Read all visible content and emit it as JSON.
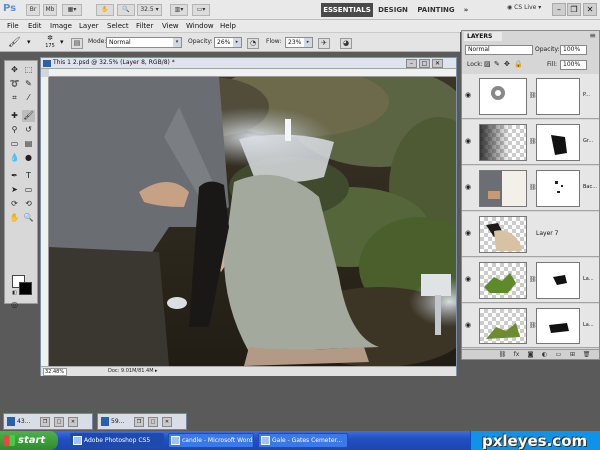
{
  "app": {
    "logo": "Ps",
    "zoom": "32.5",
    "workspaces": [
      "ESSENTIALS",
      "DESIGN",
      "PAINTING",
      "»"
    ],
    "cs_live": "CS Live"
  },
  "menu": [
    "File",
    "Edit",
    "Image",
    "Layer",
    "Select",
    "Filter",
    "View",
    "Window",
    "Help"
  ],
  "options_bar": {
    "brush_size": "175",
    "mode_label": "Mode:",
    "mode_value": "Normal",
    "opacity_label": "Opacity:",
    "opacity_value": "26%",
    "flow_label": "Flow:",
    "flow_value": "23%"
  },
  "document": {
    "title": "This 1 2.psd @ 32.5% (Layer 8, RGB/8) *",
    "zoom_field": "32.48%",
    "doc_size": "Doc: 9.01M/81.4M"
  },
  "layers_panel": {
    "tab": "LAYERS",
    "blend_mode": "Normal",
    "opacity_label": "Opacity:",
    "opacity_value": "100%",
    "lock_label": "Lock:",
    "fill_label": "Fill:",
    "fill_value": "100%",
    "layers": [
      {
        "name": "P..."
      },
      {
        "name": "Gr..."
      },
      {
        "name": "Bac..."
      },
      {
        "name": "Layer 7"
      },
      {
        "name": "La..."
      },
      {
        "name": "La..."
      }
    ],
    "footer_icons": [
      "link-icon",
      "fx-icon",
      "mask-icon",
      "adjustment-icon",
      "group-icon",
      "new-layer-icon",
      "trash-icon"
    ]
  },
  "minimized_docs": [
    "43...",
    "59..."
  ],
  "taskbar": {
    "start": "start",
    "tasks": [
      {
        "label": "Adobe Photoshop CS5",
        "active": true
      },
      {
        "label": "candle - Microsoft Word",
        "active": false
      },
      {
        "label": "Gale - Gates Cemeter...",
        "active": false
      }
    ]
  },
  "watermark": "pxleyes.com",
  "colors": {
    "accent": "#4a4a4a",
    "taskbar": "#245edb",
    "start_green": "#3c9a38"
  }
}
